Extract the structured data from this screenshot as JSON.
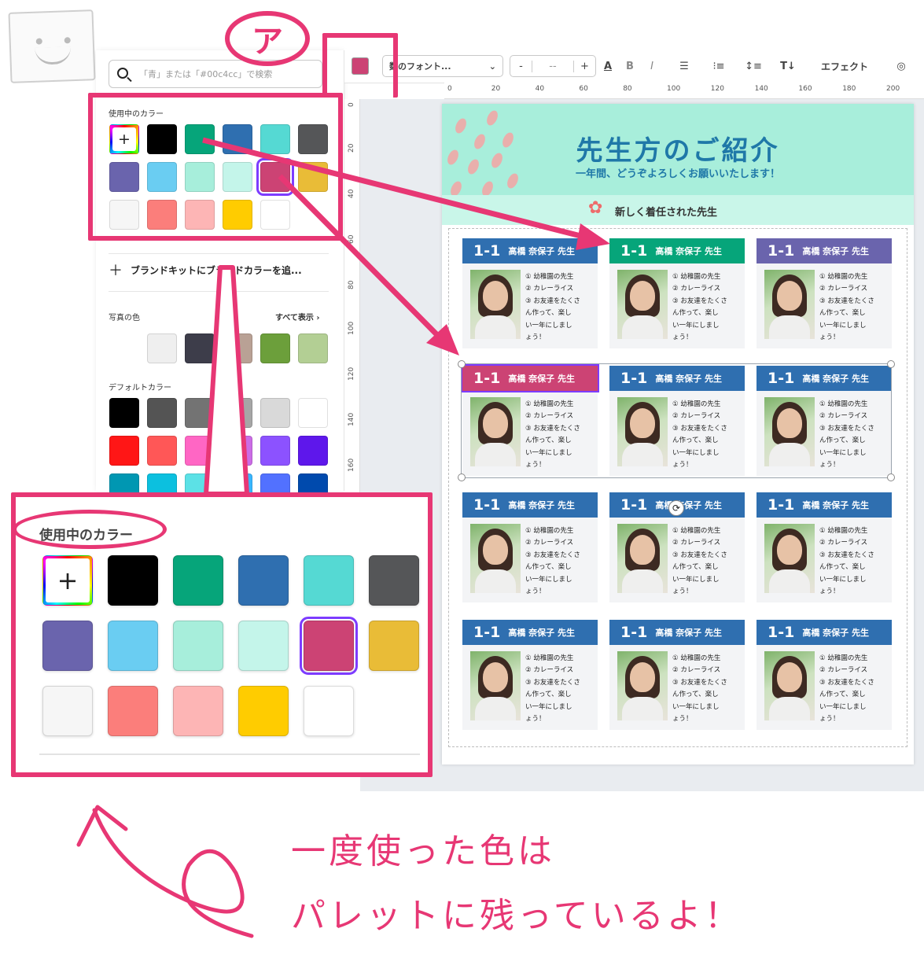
{
  "marker_label": "ア",
  "search": {
    "placeholder": "「青」または「#00c4cc」で検索"
  },
  "sections": {
    "used_colors": "使用中のカラー",
    "brand_add": "ブランドキットにブランドカラーを追...",
    "photo_colors": "写真の色",
    "show_all": "すべて表示",
    "default_colors": "デフォルトカラー"
  },
  "used_colors": [
    "rainbow-plus",
    "#000000",
    "#06a57a",
    "#2f6fb0",
    "#55d9d3",
    "#555658",
    "#6a64ad",
    "#6acdf2",
    "#a7eedb",
    "#c4f5ea",
    "#cc4374",
    "#e9bc37",
    "#f6f6f6",
    "#fb7e7b",
    "#fdb5b5",
    "#ffcc00",
    "#ffffff"
  ],
  "photo_colors": [
    "#efefef",
    "#3d3d4a",
    "#b9a195",
    "#6c9f3b",
    "#b3cf94"
  ],
  "default_colors": [
    "#000000",
    "#545454",
    "#737373",
    "#a6a6a6",
    "#d9d9d9",
    "#ffffff",
    "#ff1616",
    "#ff5757",
    "#ff66c4",
    "#cb6ce6",
    "#8c52ff",
    "#5e17eb",
    "#0097b2",
    "#0cc0df",
    "#5ce1e6",
    "#38b6ff",
    "#5271ff",
    "#004aad"
  ],
  "toolbar": {
    "current_color": "#cc4374",
    "font": "数のフォント...",
    "minus": "-",
    "size": "--",
    "plus": "+",
    "text_color_glyph": "A",
    "bold": "B",
    "italic": "I",
    "effects": "エフェクト"
  },
  "ruler_top": [
    "0",
    "20",
    "40",
    "60",
    "80",
    "100",
    "120",
    "140",
    "160",
    "180",
    "200"
  ],
  "ruler_left": [
    "0",
    "20",
    "40",
    "60",
    "80",
    "100",
    "120",
    "140",
    "160"
  ],
  "design": {
    "title": "先生方のご紹介",
    "subtitle": "一年間、どうぞよろしくお願いいたします！",
    "section": "新しく着任された先生",
    "card_class": "1-1",
    "card_name": "高橋 奈保子 先生",
    "card_lines": [
      "① 幼稚園の先生",
      "② カレーライス",
      "③ お友達をたくさ",
      "ん作って、楽し",
      "い一年にしまし",
      "ょう！"
    ],
    "card_colors": [
      "#2f6fb0",
      "#06a57a",
      "#6a64ad",
      "#cc4374",
      "#2f6fb0",
      "#2f6fb0",
      "#2f6fb0",
      "#2f6fb0",
      "#2f6fb0",
      "#2f6fb0",
      "#2f6fb0",
      "#2f6fb0"
    ]
  },
  "zoom_title": "使用中のカラー",
  "annotation": {
    "line1": "一度使った色は",
    "line2": "パレットに残っているよ！"
  },
  "accent": "#e73774"
}
